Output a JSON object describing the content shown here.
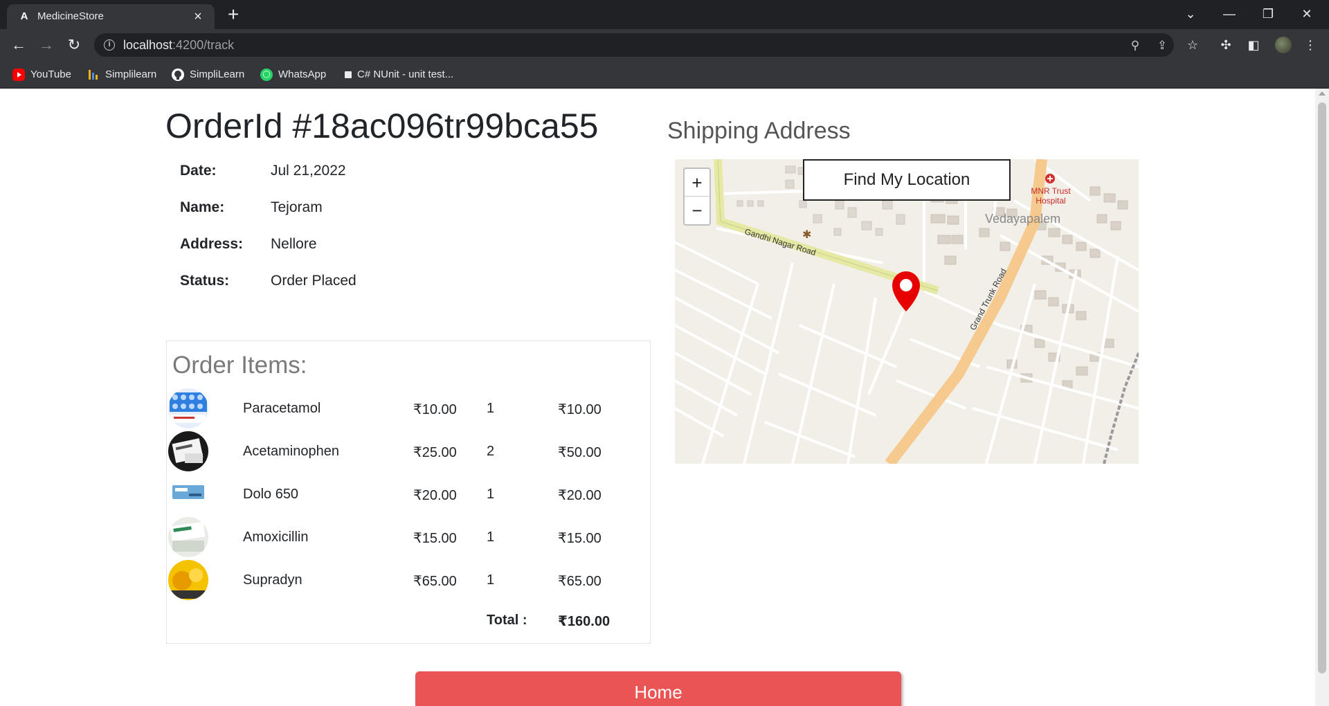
{
  "browser": {
    "tab_title": "MedicineStore",
    "url_host": "localhost",
    "url_path": ":4200/track",
    "bookmarks": [
      "YouTube",
      "Simplilearn",
      "SimpliLearn",
      "WhatsApp",
      "C# NUnit - unit test..."
    ]
  },
  "order": {
    "title": "OrderId #18ac096tr99bca55",
    "date_label": "Date:",
    "date": "Jul 21,2022",
    "name_label": "Name:",
    "name": "Tejoram",
    "address_label": "Address:",
    "address": "Nellore",
    "status_label": "Status:",
    "status": "Order Placed"
  },
  "items": {
    "title": "Order Items:",
    "rows": [
      {
        "name": "Paracetamol",
        "price": "₹10.00",
        "qty": "1",
        "subtotal": "₹10.00"
      },
      {
        "name": "Acetaminophen",
        "price": "₹25.00",
        "qty": "2",
        "subtotal": "₹50.00"
      },
      {
        "name": "Dolo 650",
        "price": "₹20.00",
        "qty": "1",
        "subtotal": "₹20.00"
      },
      {
        "name": "Amoxicillin",
        "price": "₹15.00",
        "qty": "1",
        "subtotal": "₹15.00"
      },
      {
        "name": "Supradyn",
        "price": "₹65.00",
        "qty": "1",
        "subtotal": "₹65.00"
      }
    ],
    "total_label": "Total :",
    "total": "₹160.00"
  },
  "shipping": {
    "title": "Shipping Address",
    "find_button": "Find My Location",
    "zoom_in": "+",
    "zoom_out": "−",
    "map_labels": {
      "road1": "Gandhi Nagar Road",
      "road2": "Grand Trunk Road",
      "area": "Vedayapalem",
      "hospital_line1": "MNR Trust",
      "hospital_line2": "Hospital"
    }
  },
  "home_button": "Home",
  "colors": {
    "accent": "#ea5455",
    "marker": "#e60000"
  }
}
